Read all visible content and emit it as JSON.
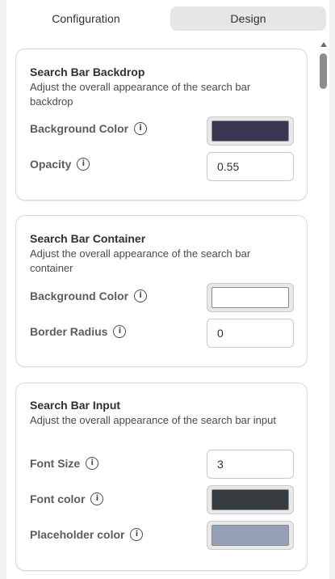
{
  "tabs": [
    {
      "label": "Configuration",
      "active": false
    },
    {
      "label": "Design",
      "active": true
    }
  ],
  "sections": [
    {
      "title": "Search Bar Backdrop",
      "description": "Adjust the overall appearance of the search bar backdrop",
      "fields": [
        {
          "label": "Background Color",
          "type": "color",
          "color": "#3b3652"
        },
        {
          "label": "Opacity",
          "type": "text",
          "value": "0.55"
        }
      ]
    },
    {
      "title": "Search Bar Container",
      "description": "Adjust the overall appearance of the search bar container",
      "fields": [
        {
          "label": "Background Color",
          "type": "color",
          "color": "#ffffff"
        },
        {
          "label": "Border Radius",
          "type": "text",
          "value": "0"
        }
      ]
    },
    {
      "title": "Search Bar Input",
      "description": "Adjust the overall appearance of the search bar input",
      "fields": [
        {
          "label": "Font Size",
          "type": "text",
          "value": "3"
        },
        {
          "label": "Font color",
          "type": "color",
          "color": "#363c40"
        },
        {
          "label": "Placeholder color",
          "type": "color",
          "color": "#93a0b5"
        }
      ]
    }
  ]
}
